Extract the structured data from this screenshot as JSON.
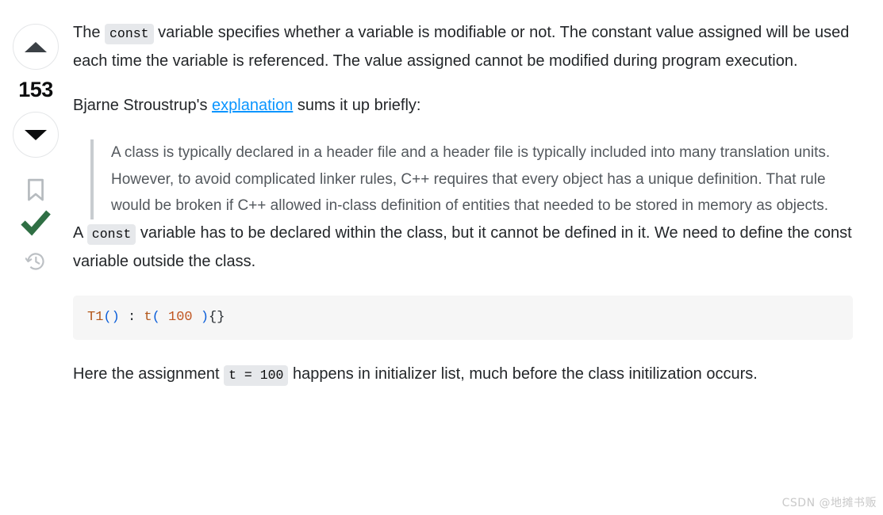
{
  "vote": {
    "upvote_label": "Up vote",
    "downvote_label": "Down vote",
    "count": "153"
  },
  "actions": {
    "bookmark_label": "Save this answer",
    "accepted_label": "Accepted answer",
    "history_label": "Timeline of edits"
  },
  "answer": {
    "paragraph1": {
      "before_code": "The ",
      "code": "const",
      "after_code": " variable specifies whether a variable is modifiable or not. The constant value assigned will be used each time the variable is referenced. The value assigned cannot be modified during program execution."
    },
    "paragraph2": {
      "before_link": "Bjarne Stroustrup's ",
      "link_text": "explanation",
      "after_link": " sums it up briefly:"
    },
    "blockquote": "A class is typically declared in a header file and a header file is typically included into many translation units. However, to avoid complicated linker rules, C++ requires that every object has a unique definition. That rule would be broken if C++ allowed in-class definition of entities that needed to be stored in memory as objects.",
    "paragraph3": {
      "before_code": "A ",
      "code": "const",
      "after_code": " variable has to be declared within the class, but it cannot be defined in it. We need to define the const variable outside the class."
    },
    "code_block": {
      "tokens": [
        {
          "text": "T1",
          "type": "fn"
        },
        {
          "text": "()",
          "type": "punc"
        },
        {
          "text": " : ",
          "type": "plain"
        },
        {
          "text": "t",
          "type": "fn"
        },
        {
          "text": "(",
          "type": "punc"
        },
        {
          "text": " ",
          "type": "plain"
        },
        {
          "text": "100",
          "type": "num"
        },
        {
          "text": " ",
          "type": "plain"
        },
        {
          "text": ")",
          "type": "punc"
        },
        {
          "text": "{}",
          "type": "plain"
        }
      ],
      "plain_text": "T1() : t( 100 ){}"
    },
    "paragraph4": {
      "before_code": "Here the assignment ",
      "code": "t = 100",
      "after_code": " happens in initializer list, much before the class initilization occurs."
    }
  },
  "watermark": {
    "text": "CSDN @地摊书贩"
  },
  "colors": {
    "link": "#0a95ff",
    "accepted_green": "#2f6f44",
    "code_bg": "#f6f6f6",
    "inline_code_bg": "#e6e8eb",
    "quote_border": "#c8ccd0",
    "quote_text": "#53585d",
    "body_text": "#232629"
  }
}
